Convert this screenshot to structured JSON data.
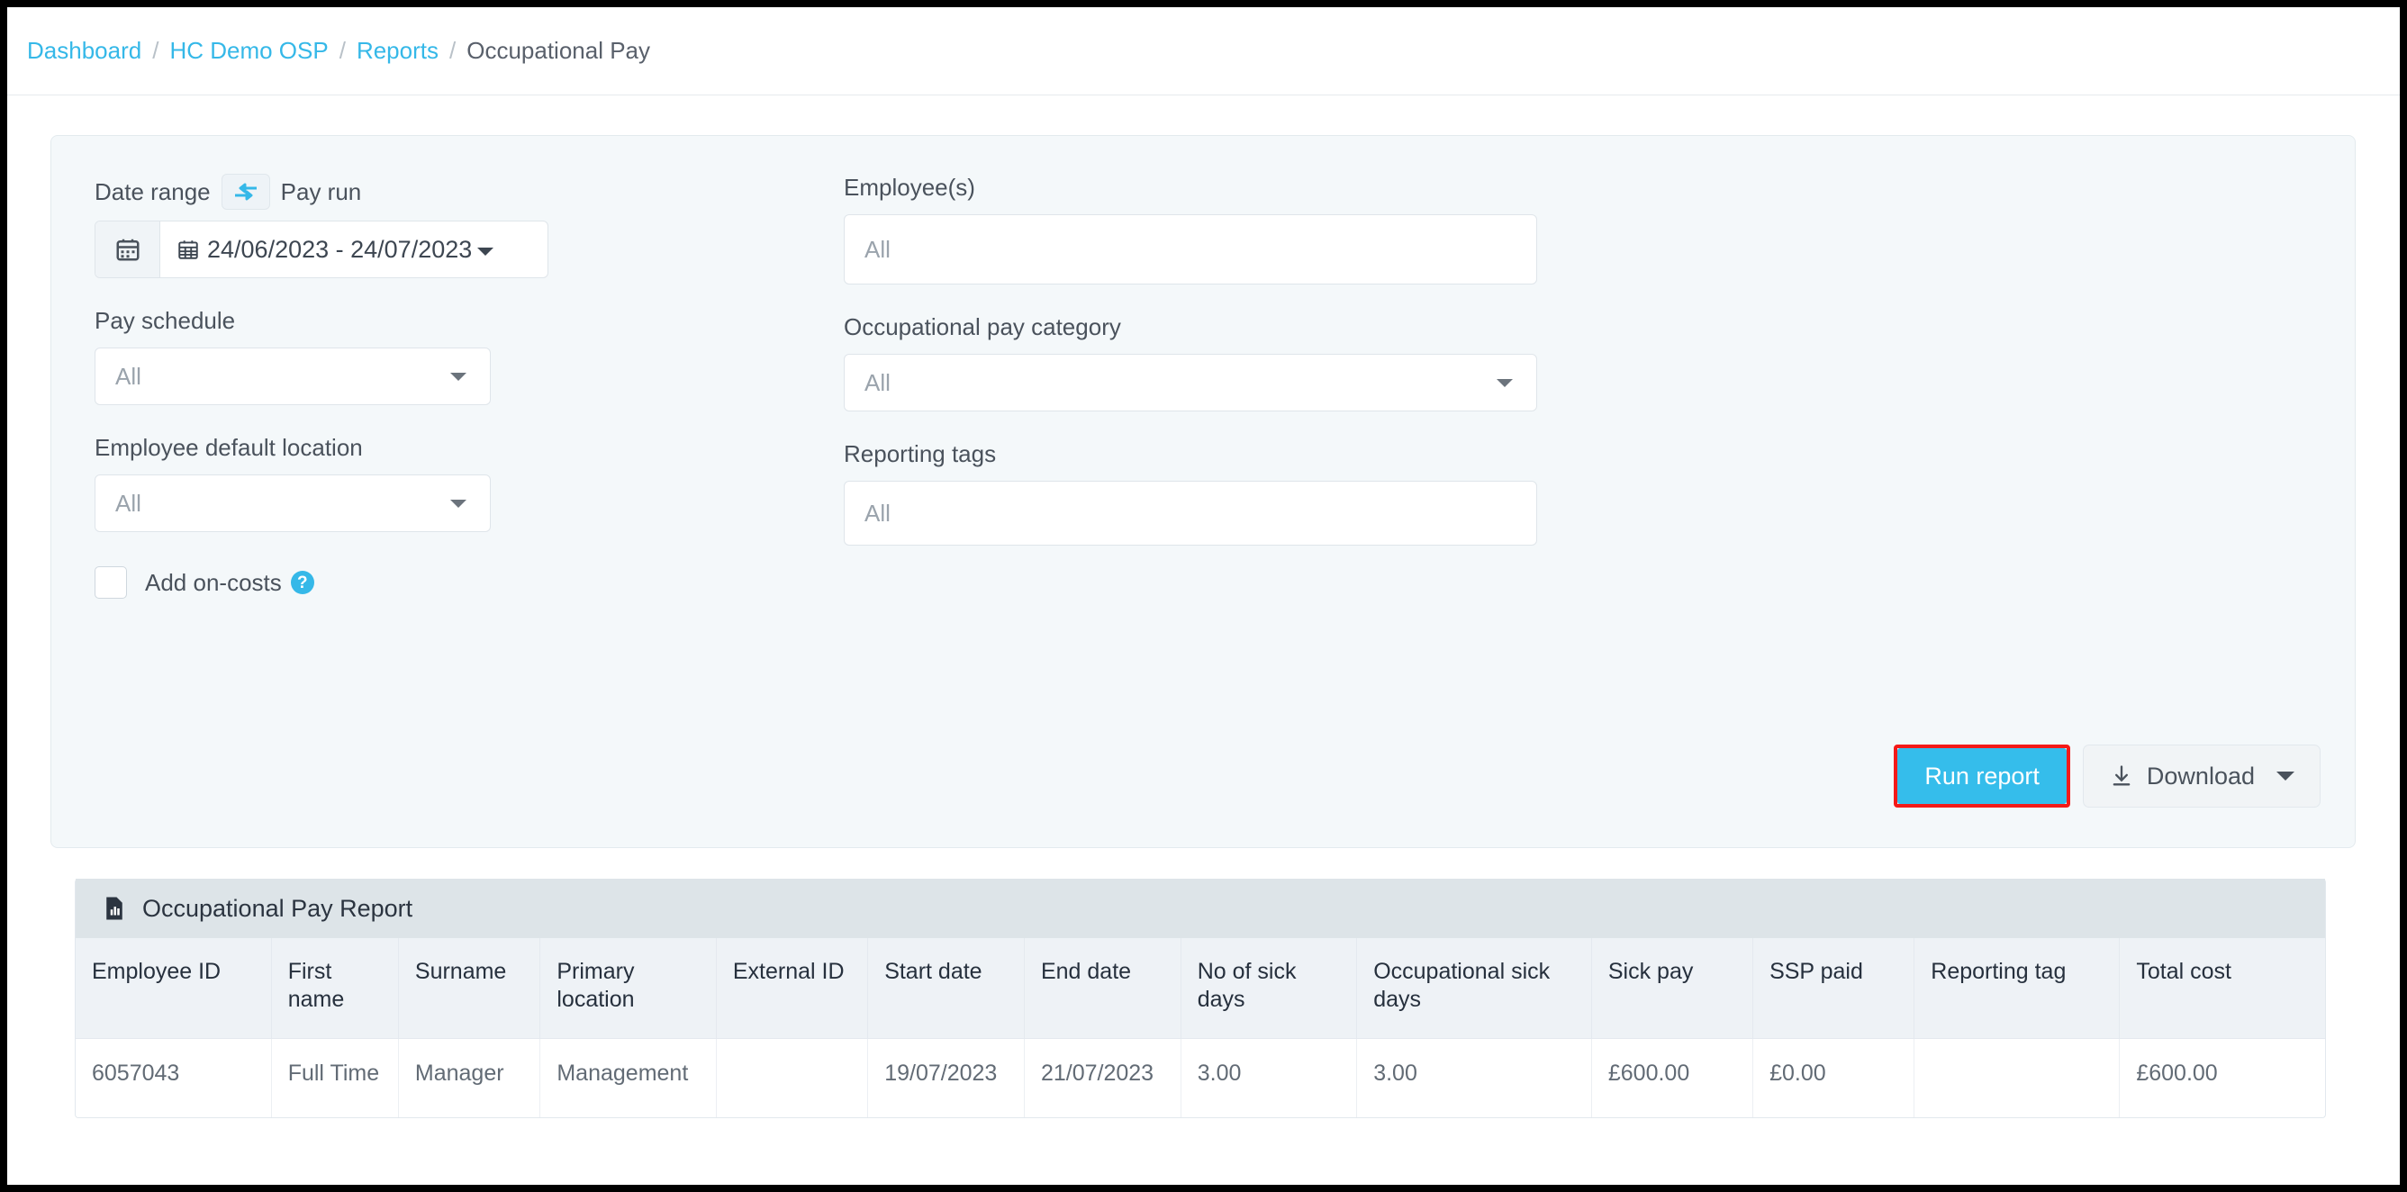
{
  "breadcrumb": {
    "items": [
      {
        "label": "Dashboard",
        "current": false
      },
      {
        "label": "HC Demo OSP",
        "current": false
      },
      {
        "label": "Reports",
        "current": false
      },
      {
        "label": "Occupational Pay",
        "current": true
      }
    ],
    "separator": "/"
  },
  "filters": {
    "date_range": {
      "label": "Date range",
      "toggle_icon": "swap-horizontal-icon",
      "alt_label": "Pay run",
      "calendar_icon": "calendar-icon",
      "value": "24/06/2023 - 24/07/2023"
    },
    "pay_schedule": {
      "label": "Pay schedule",
      "value": "All",
      "placeholder": "All"
    },
    "employee_default_location": {
      "label": "Employee default location",
      "value": "All",
      "placeholder": "All"
    },
    "employees": {
      "label": "Employee(s)",
      "value": "",
      "placeholder": "All"
    },
    "occupational_pay_category": {
      "label": "Occupational pay category",
      "value": "All",
      "placeholder": "All"
    },
    "reporting_tags": {
      "label": "Reporting tags",
      "value": "",
      "placeholder": "All"
    },
    "add_on_costs": {
      "label": "Add on-costs",
      "checked": false,
      "help_icon": "question-mark-icon",
      "help_glyph": "?"
    }
  },
  "actions": {
    "run_report_label": "Run report",
    "download_label": "Download",
    "download_icon": "download-icon",
    "highlight_color": "#f41a18",
    "primary_color": "#35bdeb"
  },
  "report": {
    "title": "Occupational Pay Report",
    "icon": "report-document-icon",
    "columns": [
      "Employee ID",
      "First name",
      "Surname",
      "Primary location",
      "External ID",
      "Start date",
      "End date",
      "No of sick days",
      "Occupational sick days",
      "Sick pay",
      "SSP paid",
      "Reporting tag",
      "Total cost"
    ],
    "rows": [
      {
        "employee_id": "6057043",
        "first_name": "Full Time",
        "surname": "Manager",
        "primary_location": "Management",
        "external_id": "",
        "start_date": "19/07/2023",
        "end_date": "21/07/2023",
        "no_of_sick_days": "3.00",
        "occupational_sick_days": "3.00",
        "sick_pay": "£600.00",
        "ssp_paid": "£0.00",
        "reporting_tag": "",
        "total_cost": "£600.00"
      }
    ]
  }
}
